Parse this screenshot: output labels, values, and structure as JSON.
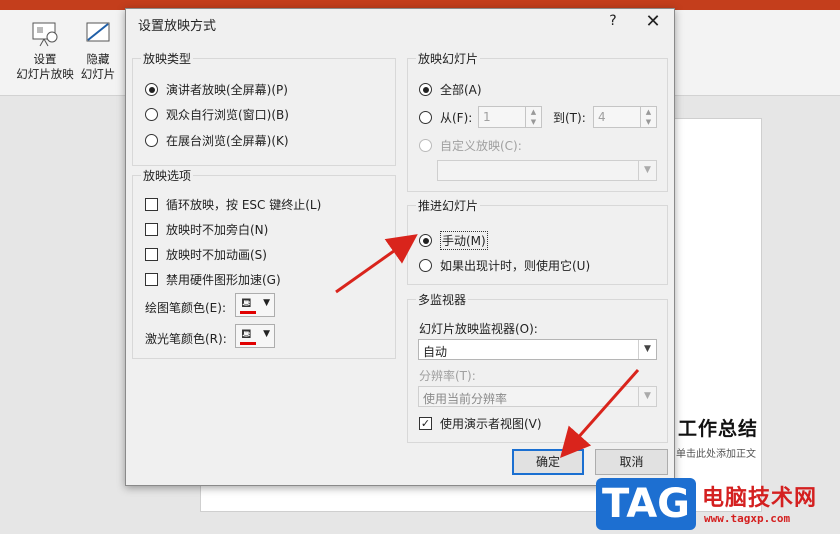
{
  "ribbon": {
    "setup_slideshow_label": "设置\n幻灯片放映",
    "hide_slide_label": "隐藏\n幻灯片"
  },
  "slide": {
    "title": "工作总结",
    "subtitle": "单击此处添加正文"
  },
  "watermark": {
    "tag": "TAG",
    "site_name": "电脑技术网",
    "url": "www.tagxp.com"
  },
  "dialog": {
    "title": "设置放映方式",
    "help": "?",
    "close": "✕",
    "show_type": {
      "legend": "放映类型",
      "options": [
        "演讲者放映(全屏幕)(P)",
        "观众自行浏览(窗口)(B)",
        "在展台浏览(全屏幕)(K)"
      ],
      "selected": 0
    },
    "show_options": {
      "legend": "放映选项",
      "checks": [
        "循环放映，按 ESC 键终止(L)",
        "放映时不加旁白(N)",
        "放映时不加动画(S)",
        "禁用硬件图形加速(G)"
      ],
      "pen_color_label": "绘图笔颜色(E):",
      "laser_color_label": "激光笔颜色(R):",
      "pen_color": "#e00000",
      "laser_color": "#e00000"
    },
    "show_slides": {
      "legend": "放映幻灯片",
      "all_label": "全部(A)",
      "from_label": "从(F):",
      "from_value": "1",
      "to_label": "到(T):",
      "to_value": "4",
      "custom_label": "自定义放映(C):",
      "custom_value": ""
    },
    "advance": {
      "legend": "推进幻灯片",
      "manual_label": "手动(M)",
      "timings_label": "如果出现计时，则使用它(U)",
      "selected": 0
    },
    "monitors": {
      "legend": "多监视器",
      "monitor_label": "幻灯片放映监视器(O):",
      "monitor_value": "自动",
      "resolution_label": "分辨率(T):",
      "resolution_value": "使用当前分辨率",
      "presenter_view_label": "使用演示者视图(V)",
      "presenter_view_checked": true
    },
    "ok_label": "确定",
    "cancel_label": "取消"
  },
  "colors": {
    "ribbon_accent": "#c43e1c",
    "annotation_arrow": "#d9241c",
    "primary_button_border": "#1a6fd1"
  }
}
